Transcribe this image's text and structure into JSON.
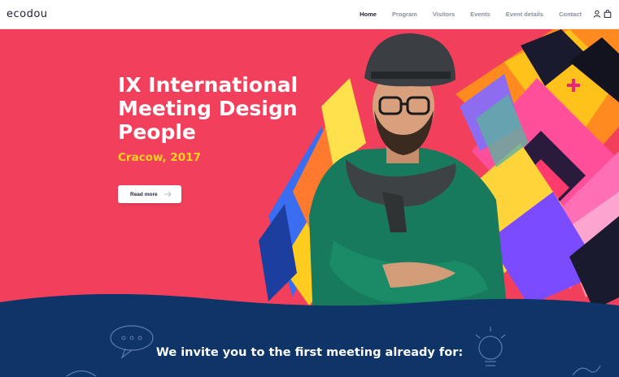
{
  "brand": {
    "logo_text": "ecodou"
  },
  "nav": {
    "items": [
      {
        "label": "Home",
        "active": true
      },
      {
        "label": "Program",
        "active": false
      },
      {
        "label": "Visitors",
        "active": false
      },
      {
        "label": "Events",
        "active": false
      },
      {
        "label": "Event details",
        "active": false
      },
      {
        "label": "Contact",
        "active": false
      }
    ]
  },
  "hero": {
    "title": "IX International Meeting Design People",
    "subtitle": "Cracow, 2017",
    "button_label": "Read more",
    "background_color": "#f2405c",
    "subtitle_color": "#ffd21f"
  },
  "invite": {
    "text": "We invite you to the first meeting already for:",
    "background_color": "#0e3468"
  }
}
